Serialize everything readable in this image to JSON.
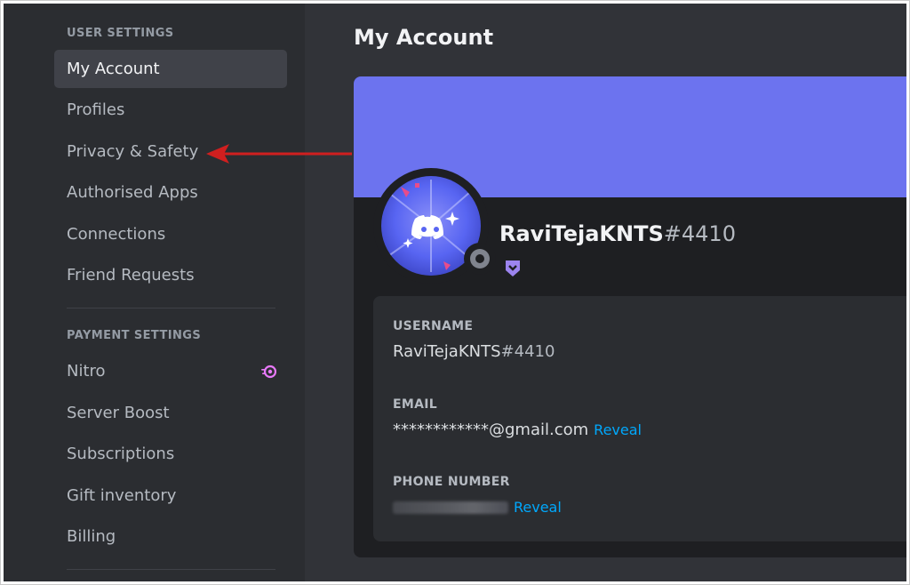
{
  "sidebar": {
    "user_settings_header": "USER SETTINGS",
    "user_items": [
      {
        "label": "My Account",
        "active": true
      },
      {
        "label": "Profiles"
      },
      {
        "label": "Privacy & Safety"
      },
      {
        "label": "Authorised Apps"
      },
      {
        "label": "Connections"
      },
      {
        "label": "Friend Requests"
      }
    ],
    "payment_settings_header": "PAYMENT SETTINGS",
    "payment_items": [
      {
        "label": "Nitro",
        "icon": "nitro-icon"
      },
      {
        "label": "Server Boost"
      },
      {
        "label": "Subscriptions"
      },
      {
        "label": "Gift inventory"
      },
      {
        "label": "Billing"
      }
    ]
  },
  "main": {
    "title": "My Account",
    "profile": {
      "username": "RaviTejaKNTS",
      "discriminator": "#4410",
      "banner_color": "#6c73ef",
      "badge_icon": "hypesquad-badge-icon",
      "status": "offline"
    },
    "fields": {
      "username_label": "USERNAME",
      "username_name": "RaviTejaKNTS",
      "username_disc": "#4410",
      "email_label": "EMAIL",
      "email_masked": "************",
      "email_domain": "@gmail.com",
      "email_reveal": "Reveal",
      "phone_label": "PHONE NUMBER",
      "phone_reveal": "Reveal"
    }
  },
  "annotation": {
    "arrow_color": "#d01f1f",
    "icon": "red-arrow-icon"
  },
  "colors": {
    "sidebar_bg": "#2b2d31",
    "main_bg": "#313338",
    "card_bg": "#1e1f22",
    "active_item_bg": "#404249",
    "link": "#00a8fc",
    "nitro": "#e879f9"
  }
}
